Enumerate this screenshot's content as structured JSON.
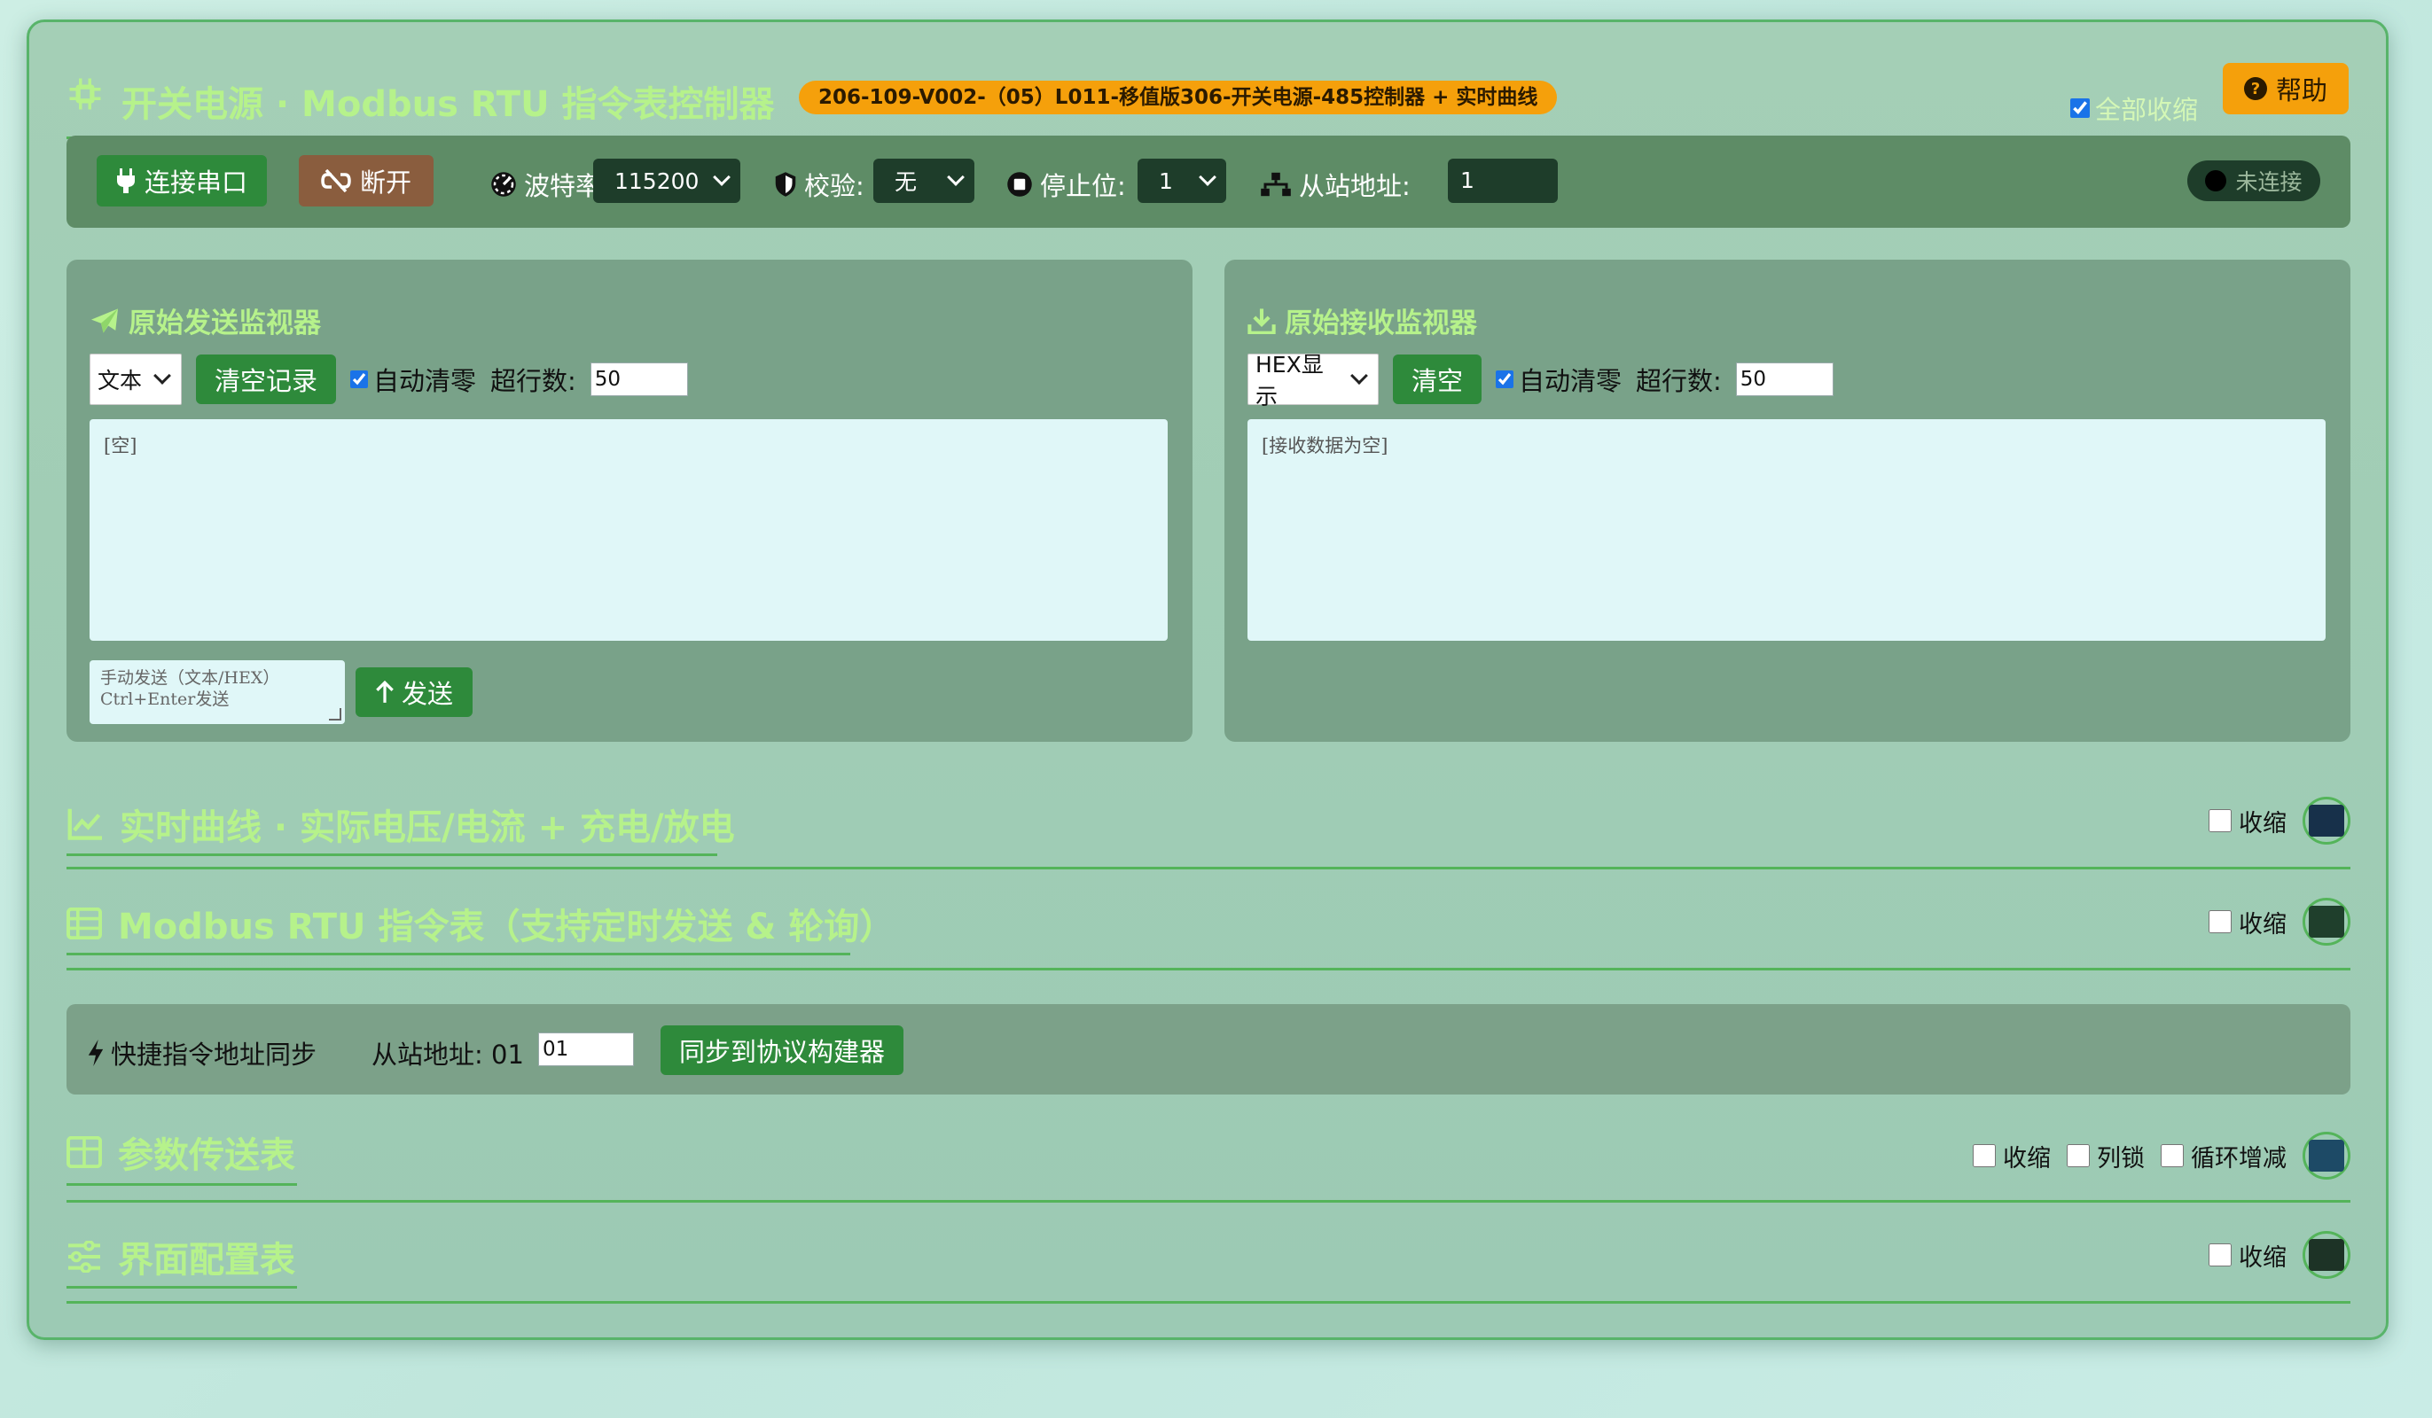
{
  "header": {
    "title": "开关电源 · Modbus RTU 指令表控制器",
    "version_badge": "206-109-V002-（05）L011-移值版306-开关电源-485控制器 + 实时曲线",
    "collapse_all_label": "全部收缩",
    "collapse_all_checked": true,
    "help_label": "帮助"
  },
  "serial": {
    "connect_label": "连接串口",
    "disconnect_label": "断开",
    "baud_label": "波特率:",
    "baud_value": "115200",
    "parity_label": "校验:",
    "parity_value": "无",
    "stopbits_label": "停止位:",
    "stopbits_value": "1",
    "slave_label": "从站地址:",
    "slave_value": "1",
    "status": "未连接"
  },
  "send_monitor": {
    "title": "原始发送监视器",
    "format_value": "文本",
    "clear_label": "清空记录",
    "auto_clear_label": "自动清零",
    "auto_clear_checked": true,
    "max_rows_label": "超行数:",
    "max_rows_value": "50",
    "content": "[空]",
    "manual_placeholder_1": "手动发送（文本/HEX）",
    "manual_placeholder_2": "Ctrl+Enter发送",
    "send_label": "发送"
  },
  "recv_monitor": {
    "title": "原始接收监视器",
    "format_value": "HEX显示",
    "clear_label": "清空",
    "auto_clear_label": "自动清零",
    "auto_clear_checked": true,
    "max_rows_label": "超行数:",
    "max_rows_value": "50",
    "content": "[接收数据为空]"
  },
  "sections": {
    "curve": {
      "title": "实时曲线 · 实际电压/电流 + 充电/放电",
      "collapse_label": "收缩",
      "swatch_color": "#17304a"
    },
    "commands": {
      "title": "Modbus RTU 指令表（支持定时发送 & 轮询）",
      "collapse_label": "收缩",
      "swatch_color": "#1f3f2c"
    },
    "params": {
      "title": "参数传送表",
      "collapse_label": "收缩",
      "lock_label": "列锁",
      "cycle_label": "循环增减",
      "swatch_color": "#1d4a66"
    },
    "ui_config": {
      "title": "界面配置表",
      "collapse_label": "收缩",
      "swatch_color": "#1d3326"
    }
  },
  "quick": {
    "label": "快捷指令地址同步",
    "addr_label": "从站地址: 01",
    "addr_value": "01",
    "sync_label": "同步到协议构建器"
  },
  "colors": {
    "accent_green": "#2e8a3b",
    "title_green": "#b6f28b",
    "badge_orange": "#f5a00b",
    "border_green": "#54b45a"
  }
}
